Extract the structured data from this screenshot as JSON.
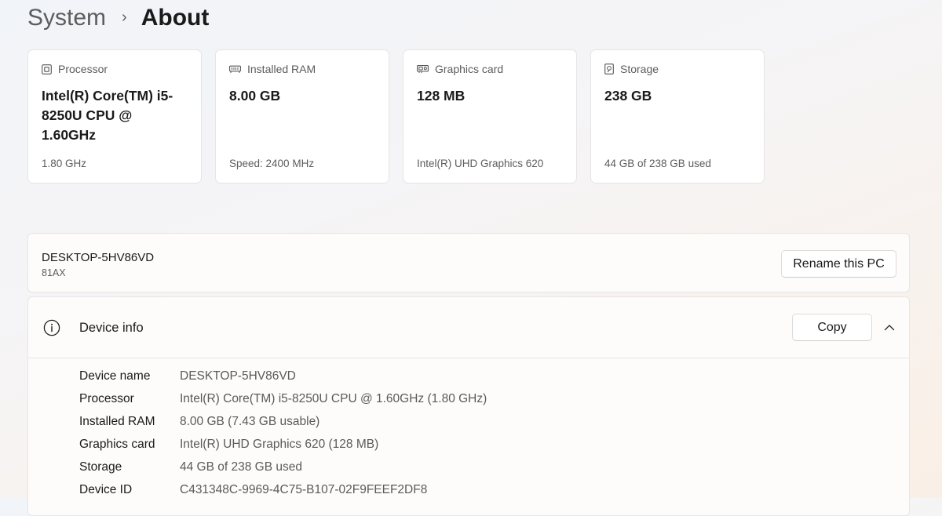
{
  "breadcrumb": {
    "parent": "System",
    "separator": "›",
    "current": "About"
  },
  "spec_cards": [
    {
      "icon": "processor-icon",
      "title": "Processor",
      "value": "Intel(R) Core(TM) i5-8250U CPU @ 1.60GHz",
      "sub": "1.80 GHz"
    },
    {
      "icon": "ram-icon",
      "title": "Installed RAM",
      "value": "8.00 GB",
      "sub": "Speed: 2400 MHz"
    },
    {
      "icon": "graphics-card-icon",
      "title": "Graphics card",
      "value": "128 MB",
      "sub": "Intel(R) UHD Graphics 620"
    },
    {
      "icon": "storage-icon",
      "title": "Storage",
      "value": "238 GB",
      "sub": "44 GB of 238 GB used"
    }
  ],
  "pc": {
    "name": "DESKTOP-5HV86VD",
    "model": "81AX",
    "rename_label": "Rename this PC"
  },
  "device_info": {
    "icon": "info-icon",
    "title": "Device info",
    "copy_label": "Copy",
    "expanded": true,
    "rows": [
      {
        "label": "Device name",
        "value": "DESKTOP-5HV86VD"
      },
      {
        "label": "Processor",
        "value": "Intel(R) Core(TM) i5-8250U CPU @ 1.60GHz (1.80 GHz)"
      },
      {
        "label": "Installed RAM",
        "value": "8.00 GB (7.43 GB usable)"
      },
      {
        "label": "Graphics card",
        "value": "Intel(R) UHD Graphics 620 (128 MB)"
      },
      {
        "label": "Storage",
        "value": "44 GB of 238 GB used"
      },
      {
        "label": "Device ID",
        "value": "C431348C-9969-4C75-B107-02F9FEEF2DF8"
      }
    ]
  }
}
